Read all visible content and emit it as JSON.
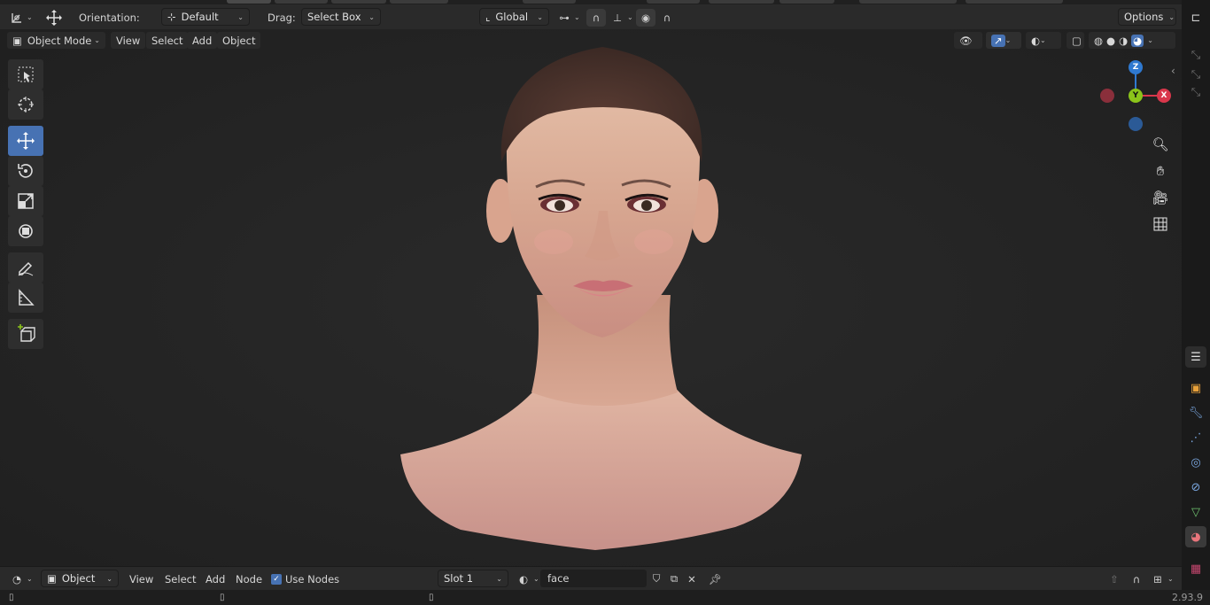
{
  "header": {
    "orientation_label": "Orientation:",
    "orientation_value": "Default",
    "drag_label": "Drag:",
    "drag_value": "Select Box",
    "transform_orientation": "Global",
    "options_label": "Options"
  },
  "viewport_header": {
    "mode": "Object Mode",
    "menus": [
      "View",
      "Select",
      "Add",
      "Object"
    ]
  },
  "gizmo": {
    "x": "X",
    "y": "Y",
    "z": "Z"
  },
  "node_header": {
    "type": "Object",
    "menus": [
      "View",
      "Select",
      "Add",
      "Node"
    ],
    "use_nodes_label": "Use Nodes",
    "use_nodes_checked": true,
    "slot": "Slot 1",
    "material_name": "face"
  },
  "status": {
    "version": "2.93.9"
  },
  "colors": {
    "accent": "#4772b3",
    "axis_x": "#d9374b",
    "axis_y": "#8bc41a",
    "axis_z": "#2f79d0"
  }
}
